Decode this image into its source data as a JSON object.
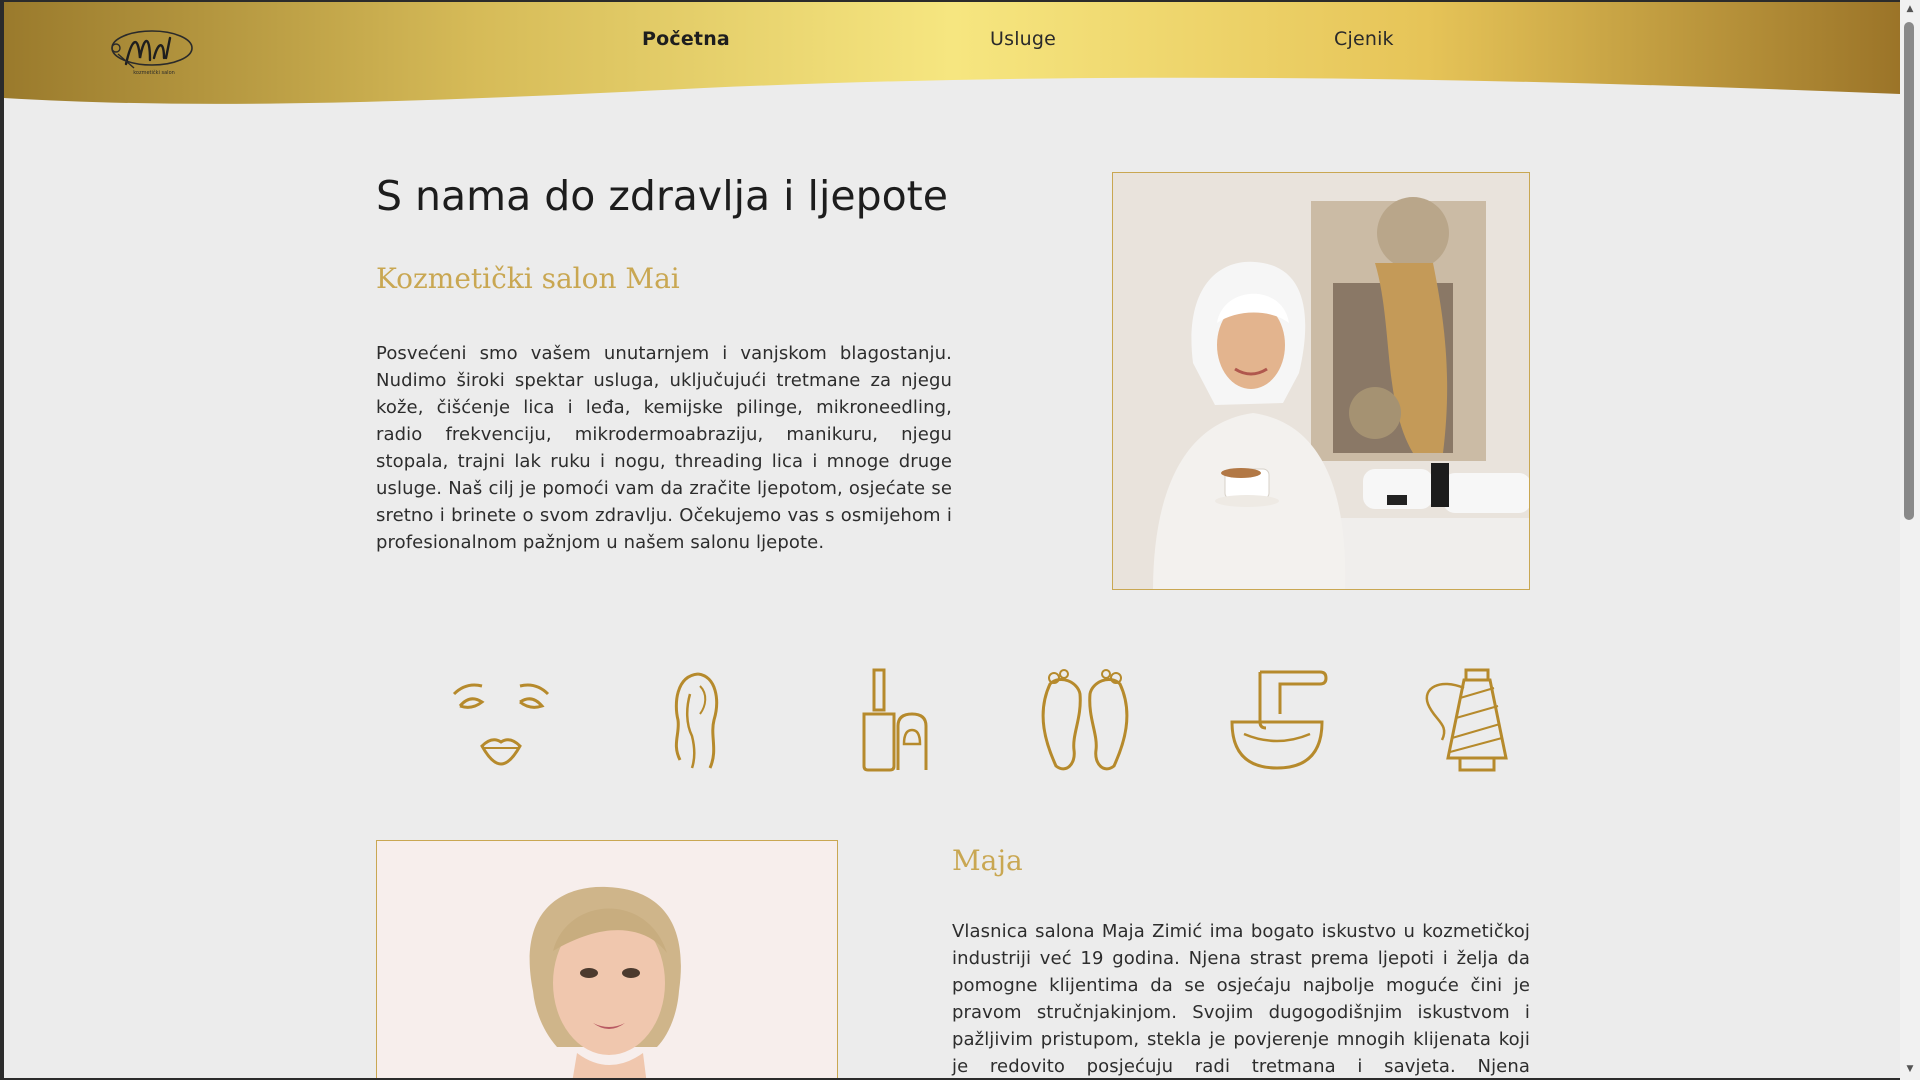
{
  "header": {
    "logo_text": "MAI",
    "logo_subtext": "kozmetički salon",
    "nav": [
      {
        "label": "Početna",
        "active": true
      },
      {
        "label": "Usluge",
        "active": false
      },
      {
        "label": "Cjenik",
        "active": false
      }
    ]
  },
  "hero": {
    "title": "S nama do zdravlja i ljepote",
    "subtitle": "Kozmetički salon Mai",
    "paragraph": "Posvećeni smo vašem unutarnjem i vanjskom blagostanju. Nudimo široki spektar usluga, uključujući tretmane za njegu kože, čišćenje lica i leđa, kemijske pilinge, mikroneedling, radio frekvenciju, mikrodermoabraziju, manikuru, njegu stopala, trajni lak ruku i nogu, threading lica i mnoge druge usluge. Naš cilj je pomoći vam da zračite ljepotom, osjećate se sretno i brinete o svom zdravlju. Očekujemo vas s osmijehom i profesionalnom pažnjom u našem salonu ljepote."
  },
  "service_icons": [
    "face-icon",
    "woman-profile-icon",
    "nail-polish-icon",
    "feet-icon",
    "wax-bowl-icon",
    "thread-spool-icon"
  ],
  "owner": {
    "name": "Maja",
    "paragraph": "Vlasnica salona Maja Zimić ima bogato iskustvo u kozmetičkoj industriji već 19 godina. Njena strast prema ljepoti i želja da pomogne klijentima da se osjećaju najbolje moguće čini je pravom stručnjakinjom. Svojim dugogodišnjim iskustvom i pažljivim pristupom, stekla je povjerenje mnogih klijenata koji je redovito posjećuju radi tretmana i savjeta. Njena posvećenost detaljima i"
  },
  "colors": {
    "gold": "#c9a752",
    "gold_dark": "#9a7a2c",
    "background": "#ececec",
    "text": "#2a2a2a"
  }
}
